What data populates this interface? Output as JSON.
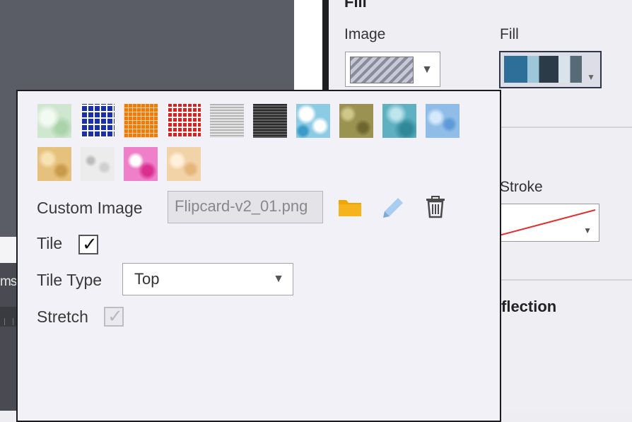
{
  "workspace": {
    "partial_text": "ms"
  },
  "properties": {
    "fill_heading": "Fill",
    "image_label": "Image",
    "fill_label": "Fill",
    "stroke_label": "Stroke",
    "reflection_label": "flection"
  },
  "icons": {
    "dropdown_arrow": "▼",
    "checkmark": "✓",
    "folder": "folder-icon",
    "pencil": "pencil-icon",
    "trash": "trash-icon"
  },
  "popup": {
    "textures": [
      {
        "name": "texture-green-marble",
        "bg": "#cfe6cf"
      },
      {
        "name": "texture-blue-grid",
        "bg": "#1a2fa8"
      },
      {
        "name": "texture-orange-grid",
        "bg": "#f07a0a"
      },
      {
        "name": "texture-red-plaid",
        "bg": "#e01e1e"
      },
      {
        "name": "texture-light-lines",
        "bg": "#c9c9c9"
      },
      {
        "name": "texture-dark-lines",
        "bg": "#3d3d3d"
      },
      {
        "name": "texture-blue-splatter",
        "bg": "#8ccbe4"
      },
      {
        "name": "texture-olive-noise",
        "bg": "#9a9250"
      },
      {
        "name": "texture-teal-marble",
        "bg": "#5fb0c0"
      },
      {
        "name": "texture-light-blue-noise",
        "bg": "#8fbde8"
      },
      {
        "name": "texture-sand-noise",
        "bg": "#e6c17d"
      },
      {
        "name": "texture-white-noise",
        "bg": "#ececec"
      },
      {
        "name": "texture-pink-splatter",
        "bg": "#ee7fc8"
      },
      {
        "name": "texture-peach-noise",
        "bg": "#f2d3a8"
      }
    ],
    "custom_image_label": "Custom Image",
    "custom_image_value": "Flipcard-v2_01.png",
    "tile_label": "Tile",
    "tile_checked": true,
    "tile_type_label": "Tile Type",
    "tile_type_value": "Top",
    "stretch_label": "Stretch",
    "stretch_checked": true,
    "colors": {
      "folder": "#f0a500",
      "pencil": "#9fc6e8",
      "trash": "#4a4a4a"
    }
  }
}
